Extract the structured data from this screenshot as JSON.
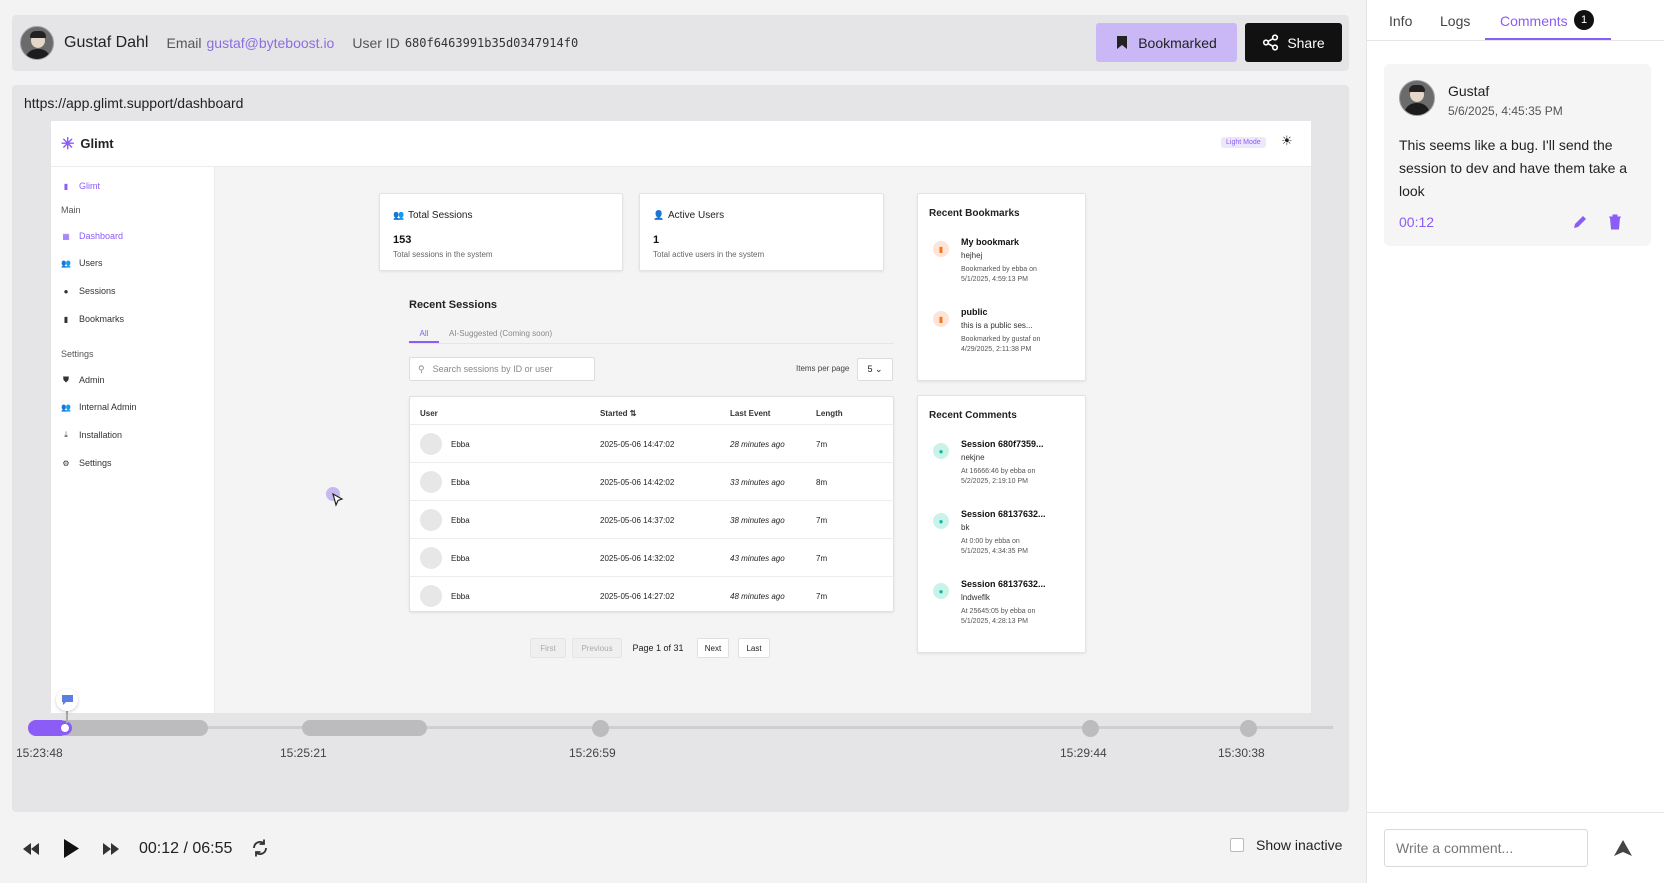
{
  "user": {
    "name": "Gustaf Dahl",
    "email_label": "Email",
    "email": "gustaf@byteboost.io",
    "id_label": "User ID",
    "id": "680f6463991b35d0347914f0"
  },
  "actions": {
    "bookmark_label": "Bookmarked",
    "share_label": "Share"
  },
  "replay": {
    "url": "https://app.glimt.support/dashboard",
    "app": {
      "logo": "Glimt",
      "light_mode": "Light Mode",
      "sidebar": {
        "brand": "Glimt",
        "main_label": "Main",
        "settings_label": "Settings",
        "items": [
          {
            "label": "Dashboard",
            "icon": "grid-icon"
          },
          {
            "label": "Users",
            "icon": "users-icon"
          },
          {
            "label": "Sessions",
            "icon": "clock-icon"
          },
          {
            "label": "Bookmarks",
            "icon": "bookmark-icon"
          }
        ],
        "settings_items": [
          {
            "label": "Admin",
            "icon": "shield-icon"
          },
          {
            "label": "Internal Admin",
            "icon": "users-icon"
          },
          {
            "label": "Installation",
            "icon": "download-icon"
          },
          {
            "label": "Settings",
            "icon": "gear-icon"
          }
        ]
      },
      "stats": [
        {
          "title": "Total Sessions",
          "value": "153",
          "desc": "Total sessions in the system"
        },
        {
          "title": "Active Users",
          "value": "1",
          "desc": "Total active users in the system"
        }
      ],
      "recent_sessions": {
        "title": "Recent Sessions",
        "tabs": [
          "All",
          "AI-Suggested (Coming soon)"
        ],
        "search_placeholder": "Search sessions by ID or user",
        "items_per_page_label": "Items per page",
        "items_per_page": "5",
        "columns": [
          "User",
          "Started",
          "Last Event",
          "Length"
        ],
        "rows": [
          {
            "user": "Ebba",
            "started": "2025-05-06 14:47:02",
            "last": "28 minutes ago",
            "length": "7m"
          },
          {
            "user": "Ebba",
            "started": "2025-05-06 14:42:02",
            "last": "33 minutes ago",
            "length": "8m"
          },
          {
            "user": "Ebba",
            "started": "2025-05-06 14:37:02",
            "last": "38 minutes ago",
            "length": "7m"
          },
          {
            "user": "Ebba",
            "started": "2025-05-06 14:32:02",
            "last": "43 minutes ago",
            "length": "7m"
          },
          {
            "user": "Ebba",
            "started": "2025-05-06 14:27:02",
            "last": "48 minutes ago",
            "length": "7m"
          }
        ],
        "pager": {
          "first": "First",
          "previous": "Previous",
          "page": "Page 1 of 31",
          "next": "Next",
          "last": "Last"
        }
      },
      "recent_bookmarks": {
        "title": "Recent Bookmarks",
        "items": [
          {
            "name": "My bookmark",
            "sub": "hejhej",
            "meta": "Bookmarked by ebba on 5/1/2025, 4:59:13 PM"
          },
          {
            "name": "public",
            "sub": "this is a public ses...",
            "meta": "Bookmarked by gustaf on 4/29/2025, 2:11:38 PM"
          }
        ]
      },
      "recent_comments": {
        "title": "Recent Comments",
        "items": [
          {
            "name": "Session 680f7359...",
            "sub": "nekjne",
            "meta": "At 16666:46 by ebba on 5/2/2025, 2:19:10 PM"
          },
          {
            "name": "Session 68137632...",
            "sub": "bk",
            "meta": "At 0:00 by ebba on 5/1/2025, 4:34:35 PM"
          },
          {
            "name": "Session 68137632...",
            "sub": "lndweflk",
            "meta": "At 25645:05 by ebba on 5/1/2025, 4:28:13 PM"
          }
        ]
      }
    },
    "timeline": {
      "labels": [
        "15:23:48",
        "15:25:21",
        "15:26:59",
        "15:29:44",
        "15:30:38"
      ],
      "progress": 0.03
    },
    "controls": {
      "current_time": "00:12",
      "total_time": "06:55",
      "time_display": "00:12 / 06:55",
      "show_inactive_label": "Show inactive",
      "show_inactive": false
    }
  },
  "panel": {
    "tabs": [
      "Info",
      "Logs",
      "Comments"
    ],
    "active_tab": "Comments",
    "comment_count": "1",
    "comments": [
      {
        "author": "Gustaf",
        "date": "5/6/2025, 4:45:35 PM",
        "text": "This seems like a bug. I'll send the session to dev and have them take a look",
        "timestamp": "00:12"
      }
    ],
    "input_placeholder": "Write a comment..."
  },
  "colors": {
    "accent": "#8b5cf6",
    "bookmark_bg": "#c9b8f5",
    "share_bg": "#111111"
  }
}
